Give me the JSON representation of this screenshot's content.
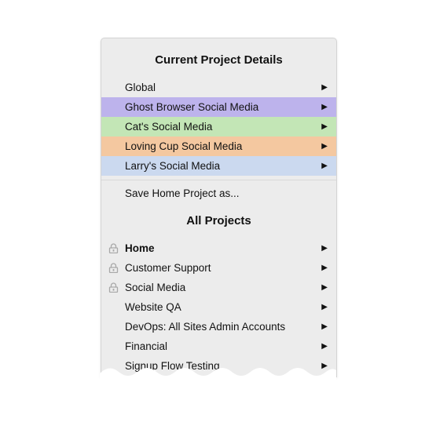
{
  "colors": {
    "menu_bg": "#ececec",
    "ghost": "#bdb3ec",
    "cat": "#c3e6b6",
    "loving": "#f4c8a0",
    "larry": "#cbd9ef"
  },
  "current": {
    "title": "Current Project Details",
    "items": [
      {
        "label": "Global",
        "arrow": "▶"
      },
      {
        "label": "Ghost Browser Social Media",
        "arrow": "▶"
      },
      {
        "label": "Cat's Social Media",
        "arrow": "▶"
      },
      {
        "label": "Loving Cup Social Media",
        "arrow": "▶"
      },
      {
        "label": "Larry's Social Media",
        "arrow": "▶"
      }
    ],
    "save_label": "Save Home Project as..."
  },
  "all": {
    "title": "All Projects",
    "items": [
      {
        "label": "Home",
        "arrow": "▶",
        "icon": "lock-icon"
      },
      {
        "label": "Customer Support",
        "arrow": "▶",
        "icon": "lock-icon"
      },
      {
        "label": "Social Media",
        "arrow": "▶",
        "icon": "lock-icon"
      },
      {
        "label": "Website QA",
        "arrow": "▶"
      },
      {
        "label": "DevOps: All Sites Admin Accounts",
        "arrow": "▶"
      },
      {
        "label": "Financial",
        "arrow": "▶"
      },
      {
        "label": "Signup Flow Testing",
        "arrow": "▶"
      }
    ]
  }
}
